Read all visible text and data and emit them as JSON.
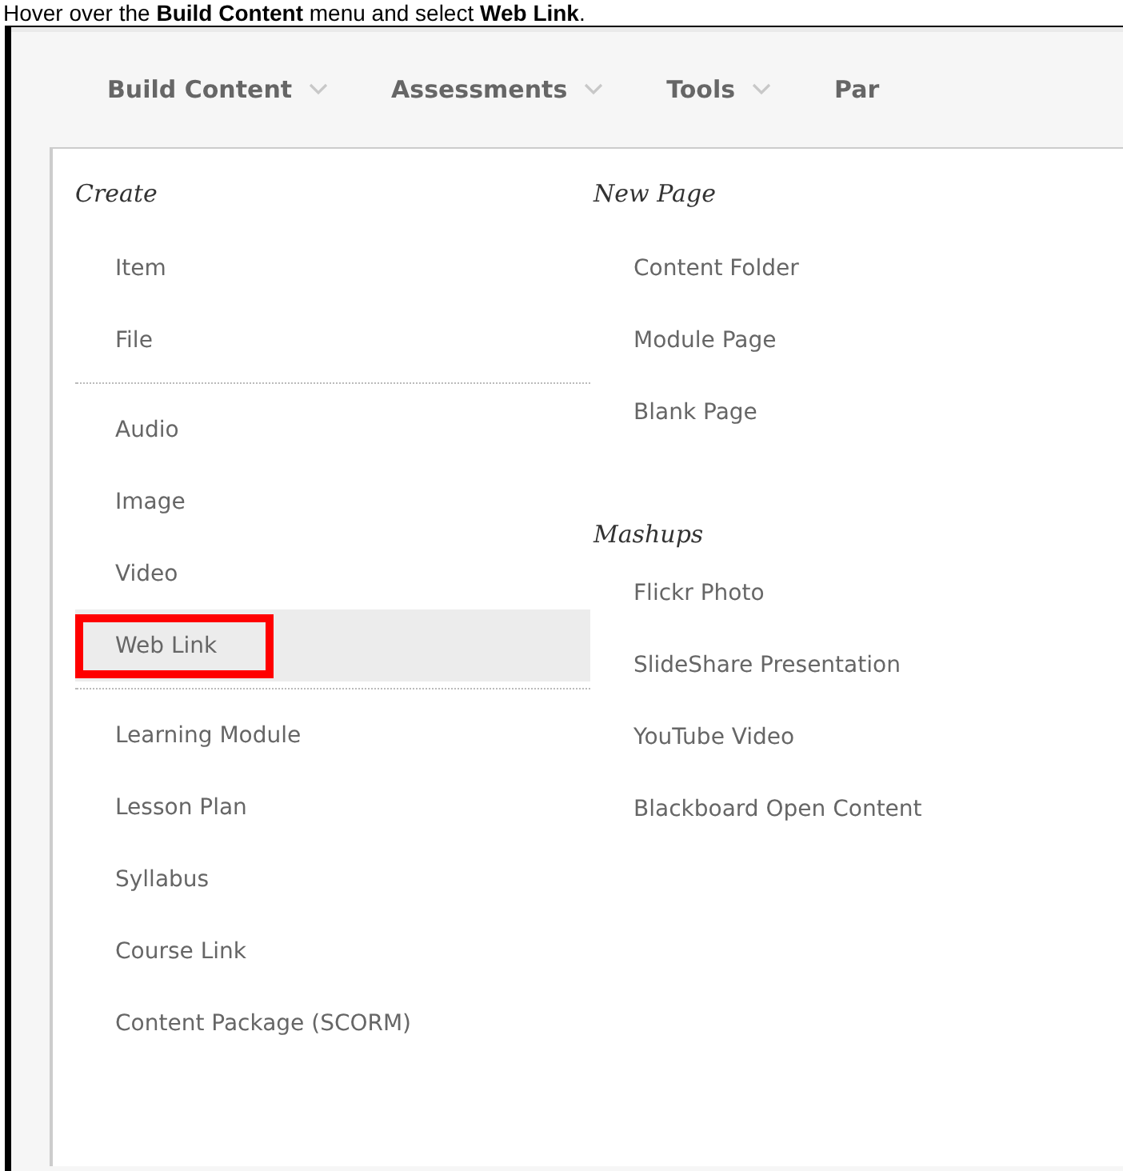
{
  "instruction": "Hover over the **Build Content** menu and select **Web Link**.",
  "menu_bar": [
    {
      "label": "Build Content",
      "caret": true
    },
    {
      "label": "Assessments",
      "caret": true
    },
    {
      "label": "Tools",
      "caret": true
    },
    {
      "label": "Par",
      "caret": false
    }
  ],
  "columns": [
    {
      "sections": [
        {
          "heading": "Create",
          "groups": [
            [
              {
                "label": "Item",
                "highlighted": false,
                "callout": false
              },
              {
                "label": "File",
                "highlighted": false,
                "callout": false
              }
            ],
            [
              {
                "label": "Audio",
                "highlighted": false,
                "callout": false
              },
              {
                "label": "Image",
                "highlighted": false,
                "callout": false
              },
              {
                "label": "Video",
                "highlighted": false,
                "callout": false
              },
              {
                "label": "Web Link",
                "highlighted": true,
                "callout": true
              }
            ],
            [
              {
                "label": "Learning Module",
                "highlighted": false,
                "callout": false
              },
              {
                "label": "Lesson Plan",
                "highlighted": false,
                "callout": false
              },
              {
                "label": "Syllabus",
                "highlighted": false,
                "callout": false
              },
              {
                "label": "Course Link",
                "highlighted": false,
                "callout": false
              },
              {
                "label": "Content Package (SCORM)",
                "highlighted": false,
                "callout": false
              }
            ]
          ]
        }
      ]
    },
    {
      "sections": [
        {
          "heading": "New Page",
          "groups": [
            [
              {
                "label": "Content Folder",
                "highlighted": false,
                "callout": false
              },
              {
                "label": "Module Page",
                "highlighted": false,
                "callout": false
              },
              {
                "label": "Blank Page",
                "highlighted": false,
                "callout": false
              }
            ]
          ]
        },
        {
          "heading": "Mashups",
          "groups": [
            [
              {
                "label": "Flickr Photo",
                "highlighted": false,
                "callout": false
              },
              {
                "label": "SlideShare Presentation",
                "highlighted": false,
                "callout": false
              },
              {
                "label": "YouTube Video",
                "highlighted": false,
                "callout": false
              },
              {
                "label": "Blackboard Open Content",
                "highlighted": false,
                "callout": false
              }
            ]
          ]
        }
      ]
    }
  ]
}
